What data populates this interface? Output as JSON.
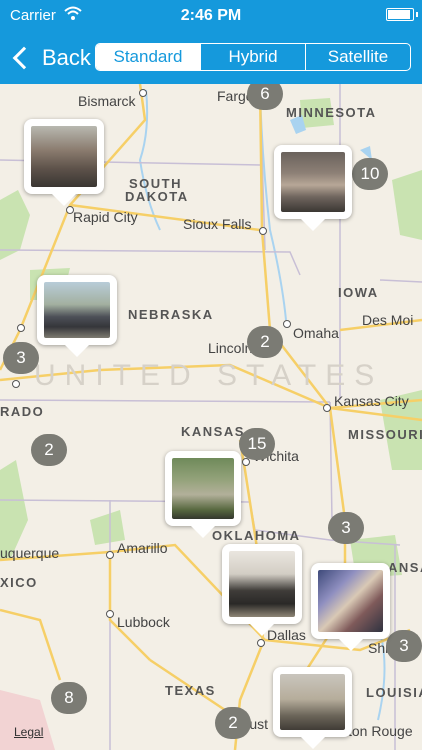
{
  "status": {
    "carrier": "Carrier",
    "time": "2:46 PM"
  },
  "nav": {
    "back_label": "Back",
    "segments": [
      {
        "label": "Standard",
        "active": true
      },
      {
        "label": "Hybrid",
        "active": false
      },
      {
        "label": "Satellite",
        "active": false
      }
    ]
  },
  "map": {
    "country_label": "UNITED STATES",
    "states": [
      "MINNESOTA",
      "SOUTH",
      "DAKOTA",
      "IOWA",
      "NEBRASKA",
      "KANSAS",
      "MISSOURI",
      "RADO",
      "OKLAHOMA",
      "XICO",
      "TEXAS",
      "LOUISIAN",
      "ANSA"
    ],
    "cities": [
      "Bismarck",
      "Fargo",
      "Rapid City",
      "Sioux Falls",
      "Omaha",
      "Des Moi",
      "Lincoln",
      "Kansas City",
      "Wichita",
      "uquerque",
      "Amarillo",
      "Lubbock",
      "Dallas",
      "Shrevep",
      "Aust",
      "ton Rouge"
    ],
    "clusters": [
      "6",
      "10",
      "3",
      "2",
      "2",
      "15",
      "3",
      "3",
      "8",
      "2"
    ],
    "legal": "Legal"
  },
  "colors": {
    "nav_bg": "#1599dc",
    "cluster_bg": "#7b7b74",
    "land": "#f3efe6",
    "highway": "#f6cf67",
    "water": "#a9d3f0",
    "park": "#c9e3b1"
  }
}
